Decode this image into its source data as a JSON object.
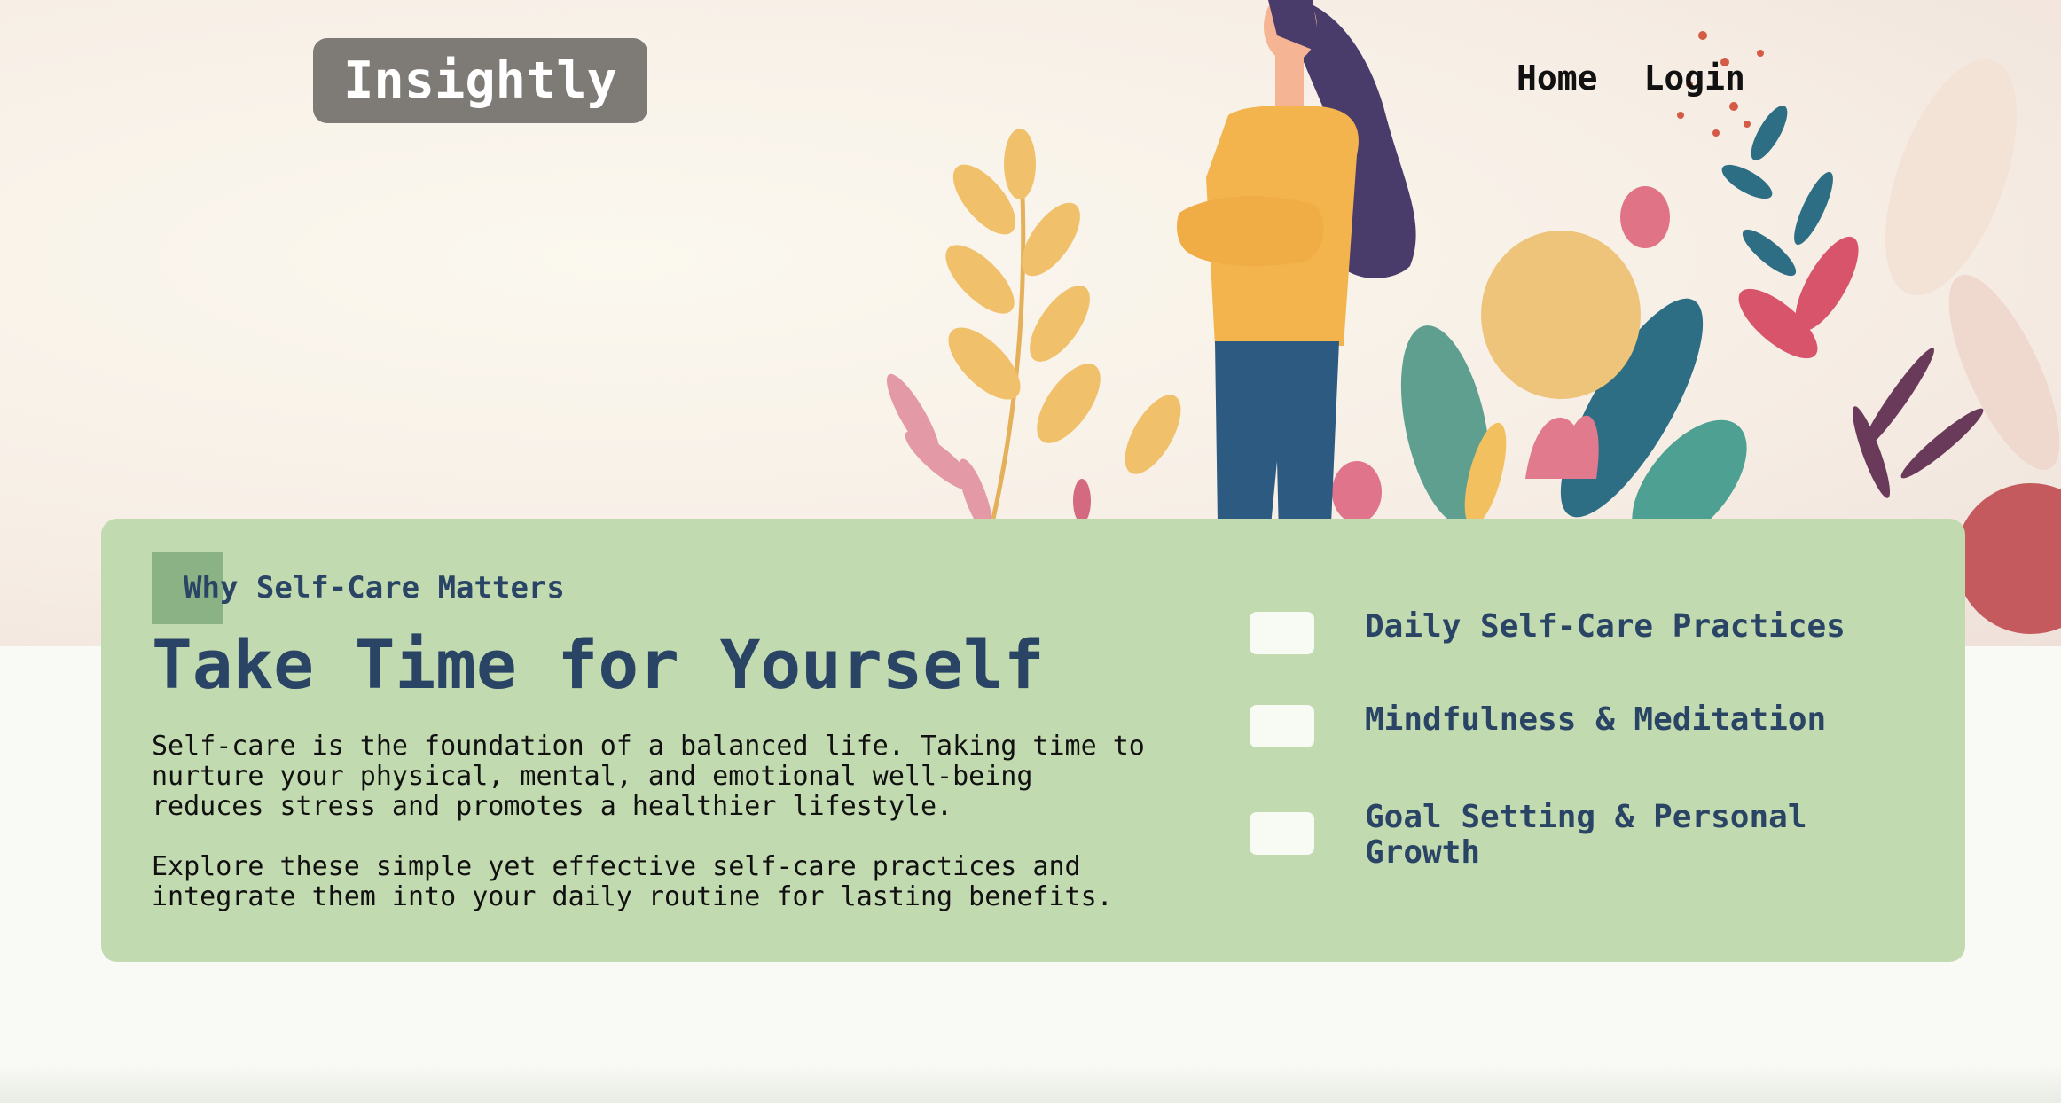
{
  "header": {
    "logo": "Insightly",
    "nav": [
      "Home",
      "Login"
    ]
  },
  "hero": {
    "illustration": "woman-with-plants-illustration"
  },
  "section": {
    "tag": "Why Self-Care Matters",
    "title": "Take Time for Yourself",
    "paragraphs": [
      "Self-care is the foundation of a balanced life. Taking time to nurture your physical, mental, and emotional well-being reduces stress and promotes a healthier lifestyle.",
      "Explore these simple yet effective self-care practices and integrate them into your daily routine for lasting benefits."
    ],
    "features": [
      "Daily Self-Care Practices",
      "Mindfulness & Meditation",
      "Goal Setting & Personal Growth"
    ]
  },
  "colors": {
    "card": "#c2daaf",
    "accent": "#2a4466",
    "tag_block": "#8ab284",
    "logo_bg": "#7e7b76"
  }
}
